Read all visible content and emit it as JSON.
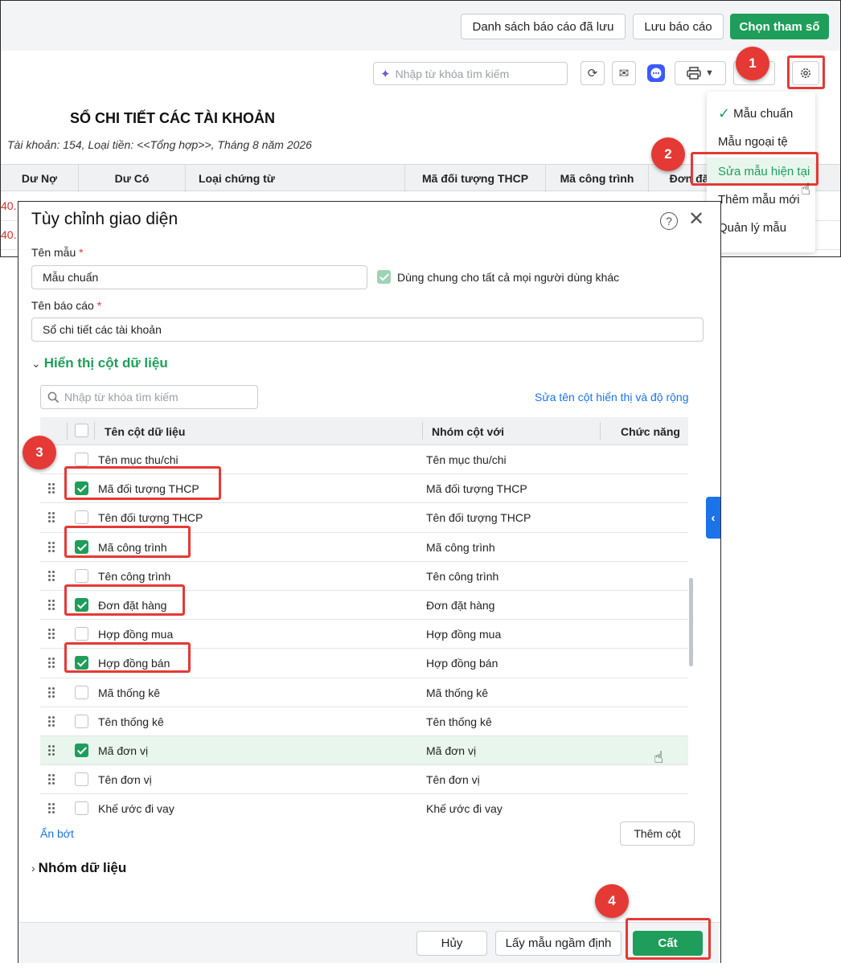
{
  "toolbar": {
    "saved_reports_label": "Danh sách báo cáo đã lưu",
    "save_report_label": "Lưu báo cáo",
    "choose_params_label": "Chọn tham số",
    "search_placeholder": "Nhập từ khóa tìm kiếm"
  },
  "report": {
    "title": "SỔ CHI TIẾT CÁC TÀI KHOẢN",
    "subtitle": "Tài khoản: 154, Loại tiền: <<Tổng hợp>>, Tháng 8 năm 2026",
    "columns": [
      "Dư Nợ",
      "Dư Có",
      "Loại chứng từ",
      "Mã đối tượng THCP",
      "Mã công trình",
      "Đơn đặ"
    ],
    "row_values": [
      "40.",
      "40."
    ]
  },
  "template_menu": {
    "items": [
      "Mẫu chuẩn",
      "Mẫu ngoại tệ",
      "Sửa mẫu hiện tại",
      "Thêm mẫu mới",
      "Quản lý mẫu"
    ],
    "selected_index": 0,
    "active_index": 2
  },
  "badges": [
    "1",
    "2",
    "3",
    "4"
  ],
  "dialog": {
    "title": "Tùy chỉnh giao diện",
    "template_name_label": "Tên mẫu",
    "template_name_value": "Mẫu chuẩn",
    "share_label": "Dùng chung cho tất cả mọi người dùng khác",
    "report_name_label": "Tên báo cáo",
    "report_name_value": "Sổ chi tiết các tài khoản",
    "required_mark": "*",
    "columns_section_title": "Hiển thị cột dữ liệu",
    "search_placeholder": "Nhập từ khóa tìm kiếm",
    "edit_columns_link": "Sửa tên cột hiển thị và độ rộng",
    "grid_headers": {
      "name": "Tên cột dữ liệu",
      "group": "Nhóm cột với",
      "function": "Chức năng"
    },
    "rows": [
      {
        "name": "Tên mục thu/chi",
        "group": "Tên mục thu/chi",
        "checked": false
      },
      {
        "name": "Mã đối tượng THCP",
        "group": "Mã đối tượng THCP",
        "checked": true
      },
      {
        "name": "Tên đối tượng THCP",
        "group": "Tên đối tượng THCP",
        "checked": false
      },
      {
        "name": "Mã công trình",
        "group": "Mã công trình",
        "checked": true
      },
      {
        "name": "Tên công trình",
        "group": "Tên công trình",
        "checked": false
      },
      {
        "name": "Đơn đặt hàng",
        "group": "Đơn đặt hàng",
        "checked": true
      },
      {
        "name": "Hợp đồng mua",
        "group": "Hợp đồng mua",
        "checked": false
      },
      {
        "name": "Hợp đồng bán",
        "group": "Hợp đồng bán",
        "checked": true
      },
      {
        "name": "Mã thống kê",
        "group": "Mã thống kê",
        "checked": false
      },
      {
        "name": "Tên thống kê",
        "group": "Tên thống kê",
        "checked": false
      },
      {
        "name": "Mã đơn vị",
        "group": "Mã đơn vị",
        "checked": true
      },
      {
        "name": "Tên đơn vị",
        "group": "Tên đơn vị",
        "checked": false
      },
      {
        "name": "Khế ước đi vay",
        "group": "Khế ước đi vay",
        "checked": false
      }
    ],
    "show_less_link": "Ẩn bớt",
    "add_column_label": "Thêm cột",
    "group_section_title": "Nhóm dữ liệu",
    "cancel_label": "Hủy",
    "default_label": "Lấy mẫu ngầm định",
    "save_label": "Cất"
  },
  "colors": {
    "brand_green": "#1e9e5a",
    "highlight_red": "#e53935",
    "link_blue": "#1a73e8"
  }
}
